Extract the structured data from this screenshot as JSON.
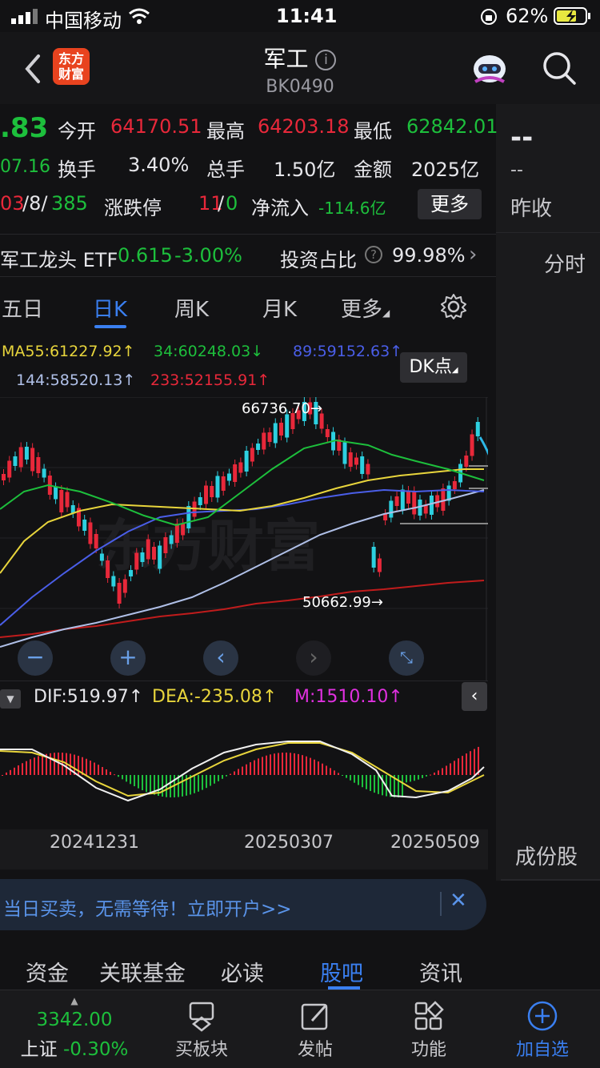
{
  "status_bar": {
    "carrier": "中国移动",
    "time": "11:41",
    "battery": "62%"
  },
  "header": {
    "logo_text_1": "东方",
    "logo_text_2": "财富",
    "title": "军工",
    "subtitle": "BK0490"
  },
  "quote": {
    "price_partial": ".83",
    "change_partial": "07.16",
    "counts_partial_red": "03",
    "counts_partial_mid": "/8/",
    "counts_partial_green": "385",
    "open_label": "今开",
    "open_value": "64170.51",
    "high_label": "最高",
    "high_value": "64203.18",
    "low_label": "最低",
    "low_value": "62842.01",
    "turnover_label": "换手",
    "turnover_value": "3.40%",
    "volume_label": "总手",
    "volume_value": "1.50亿",
    "amount_label": "金额",
    "amount_value": "2025亿",
    "limit_label": "涨跌停",
    "limit_up": "11",
    "limit_sep": "/",
    "limit_down": "0",
    "netflow_label": "净流入",
    "netflow_value": "-114.6亿",
    "more_button": "更多",
    "right_dash_1": "--",
    "right_dash_2": "--",
    "prev_close_label": "昨收"
  },
  "etf": {
    "name": "军工龙头 ETF",
    "price": "0.615",
    "change": "-3.00%",
    "ratio_label": "投资占比",
    "ratio_value": "99.98%"
  },
  "right_panel": {
    "tab_intraday": "分时",
    "tab_constituents": "成份股"
  },
  "period_tabs": [
    "五日",
    "日K",
    "周K",
    "月K",
    "更多"
  ],
  "ma_legend": {
    "ma55": "MA55:61227.92↑",
    "ma34": "34:60248.03↓",
    "ma89": "89:59152.63↑",
    "ma144": "144:58520.13↑",
    "ma233": "233:52155.91↑",
    "dk_button": "DK点"
  },
  "chart_annotations": {
    "high": "66736.70→",
    "low": "50662.99→",
    "watermark": "东方财富"
  },
  "macd": {
    "dif": "DIF:519.97↑",
    "dea": "DEA:-235.08↑",
    "m": "M:1510.10↑"
  },
  "dates": [
    "20241231",
    "20250307",
    "20250509"
  ],
  "promo": {
    "text": "当日买卖，无需等待！立即开户>>"
  },
  "sub_tabs": [
    "资金",
    "关联基金",
    "必读",
    "股吧",
    "资讯"
  ],
  "bottom_nav": {
    "index_value": "3342.00",
    "index_name": "上证",
    "index_change": "-0.30%",
    "items": [
      "买板块",
      "发帖",
      "功能",
      "加自选"
    ]
  },
  "colors": {
    "up": "#e8283a",
    "down": "#1dbf3c",
    "accent": "#3a7ff0",
    "ma55": "#e8d53c",
    "ma34": "#1dbf3c",
    "ma89": "#4a5ee8",
    "ma144": "#b0c0e8",
    "ma233": "#d02020"
  }
}
